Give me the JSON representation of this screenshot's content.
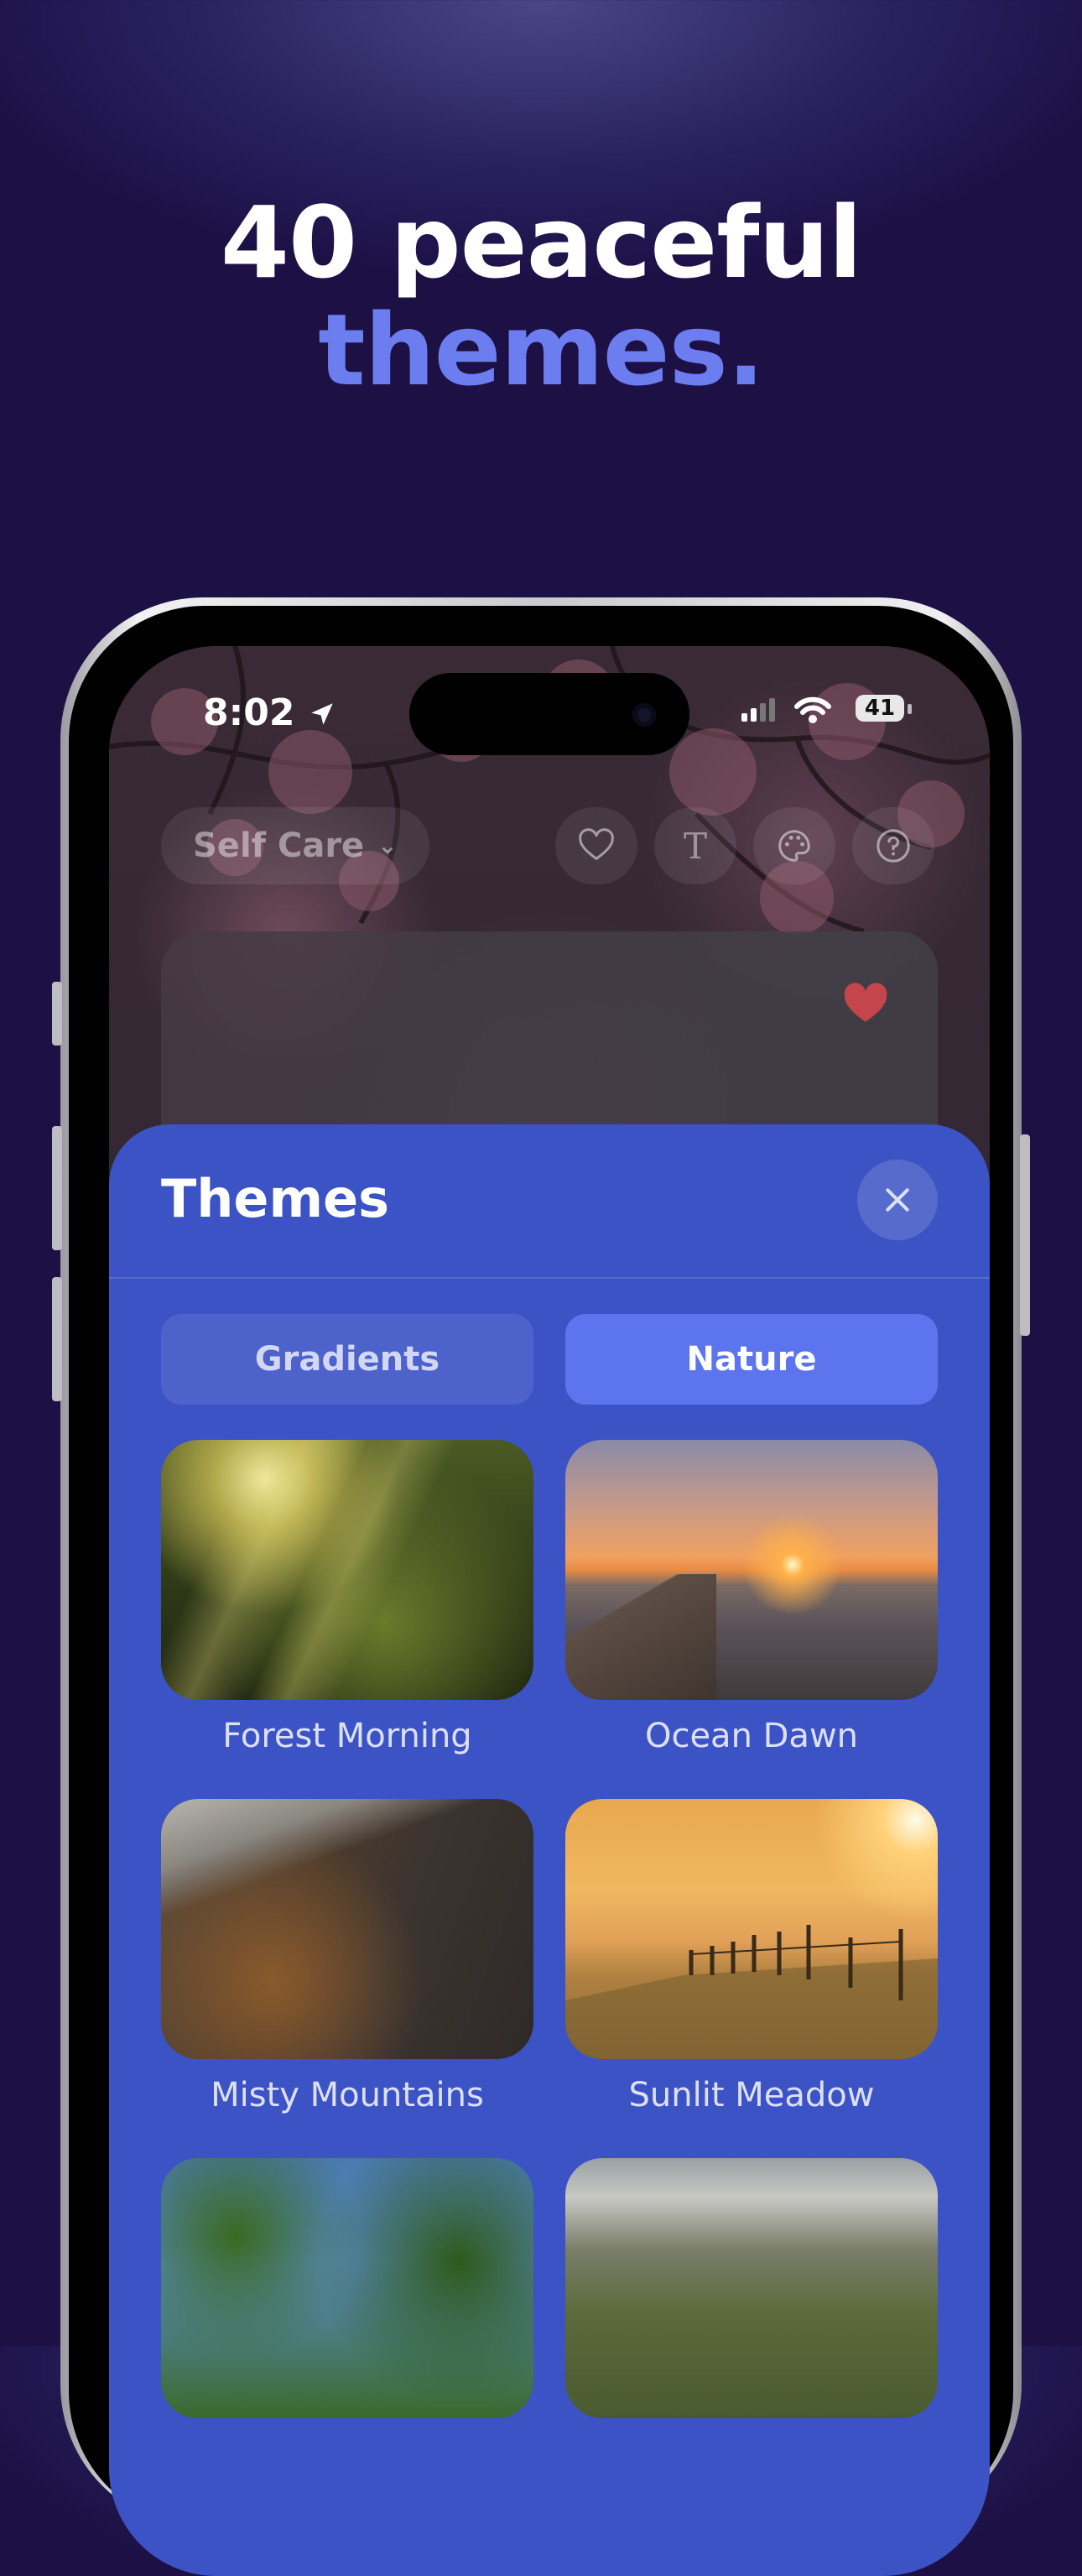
{
  "headline": {
    "line1": "40 peaceful",
    "line2": "themes."
  },
  "status_bar": {
    "time": "8:02",
    "battery": "41"
  },
  "top_bar": {
    "category": "Self Care",
    "icons": [
      "heart-outline-icon",
      "text-font-icon",
      "palette-icon",
      "help-icon"
    ]
  },
  "quote_card": {
    "favorited": true
  },
  "sheet": {
    "title": "Themes",
    "tabs": [
      {
        "label": "Gradients",
        "selected": false
      },
      {
        "label": "Nature",
        "selected": true
      }
    ],
    "themes": [
      {
        "label": "Forest Morning"
      },
      {
        "label": "Ocean Dawn"
      },
      {
        "label": "Misty Mountains"
      },
      {
        "label": "Sunlit Meadow"
      },
      {
        "label": ""
      },
      {
        "label": ""
      }
    ]
  },
  "colors": {
    "accent": "#6c7df0",
    "sheet": "#3c53c5",
    "selected_tab": "#5c74ee"
  }
}
